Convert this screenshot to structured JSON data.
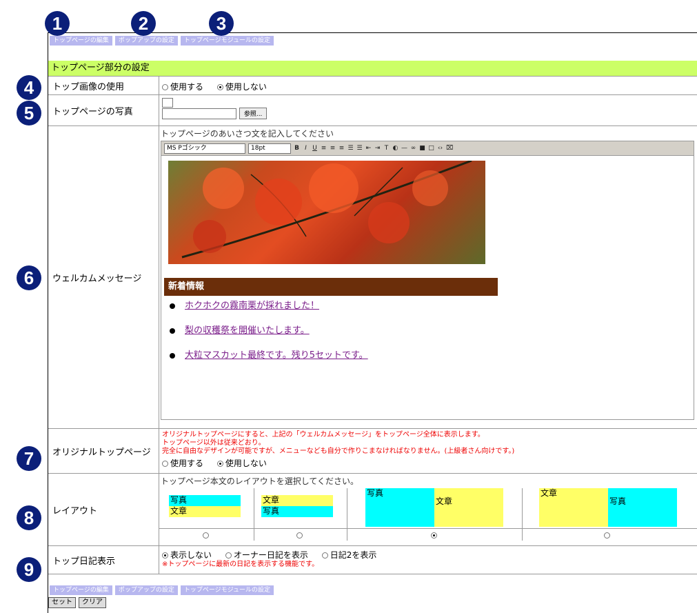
{
  "markers": [
    "1",
    "2",
    "3",
    "4",
    "5",
    "6",
    "7",
    "8",
    "9"
  ],
  "tabs": {
    "top": [
      "トップページの編集",
      "ポップアップの設定",
      "トップページモジュールの設定"
    ],
    "bottom": [
      "トップページの編集",
      "ポップアップの設定",
      "トップページモジュールの設定"
    ]
  },
  "section_title": "トップページ部分の設定",
  "rows": {
    "image_use": {
      "label": "トップ画像の使用",
      "options": [
        "使用する",
        "使用しない"
      ],
      "selected": 1
    },
    "photo": {
      "label": "トップページの写真",
      "browse": "参照..."
    },
    "welcome": {
      "label": "ウェルカムメッセージ",
      "hint": "トップページのあいさつ文を記入してください",
      "font": "MS Pゴシック",
      "size": "18pt",
      "news_title": "新着情報",
      "news": [
        "ホクホクの霧南栗が採れました！",
        "梨の収穫祭を開催いたします。",
        "大粒マスカット最終です。残り5セットです。"
      ]
    },
    "original": {
      "label": "オリジナルトップページ",
      "note1": "オリジナルトップページにすると、上記の「ウェルカムメッセージ」をトップページ全体に表示します。",
      "note2": "トップページ以外は従来どおり。",
      "note3": "完全に自由なデザインが可能ですが、メニューなども自分で作りこまなければなりません。(上級者さん向けです。)",
      "options": [
        "使用する",
        "使用しない"
      ],
      "selected": 1
    },
    "layout": {
      "label": "レイアウト",
      "hint": "トップページ本文のレイアウトを選択してください。",
      "photo": "写真",
      "text": "文章",
      "selected": 2
    },
    "diary": {
      "label": "トップ日記表示",
      "options": [
        "表示しない",
        "オーナー日記を表示",
        "日記2を表示"
      ],
      "selected": 0,
      "note": "※トップページに最新の日記を表示する機能です。"
    }
  },
  "buttons": {
    "set": "セット",
    "clear": "クリア"
  },
  "colors": {
    "marker": "#0b1f79",
    "section": "#ccff66",
    "cyan": "#00ffff",
    "yellow": "#ffff66",
    "news_bar": "#6b2e0a",
    "tab": "#b7b7ef"
  }
}
